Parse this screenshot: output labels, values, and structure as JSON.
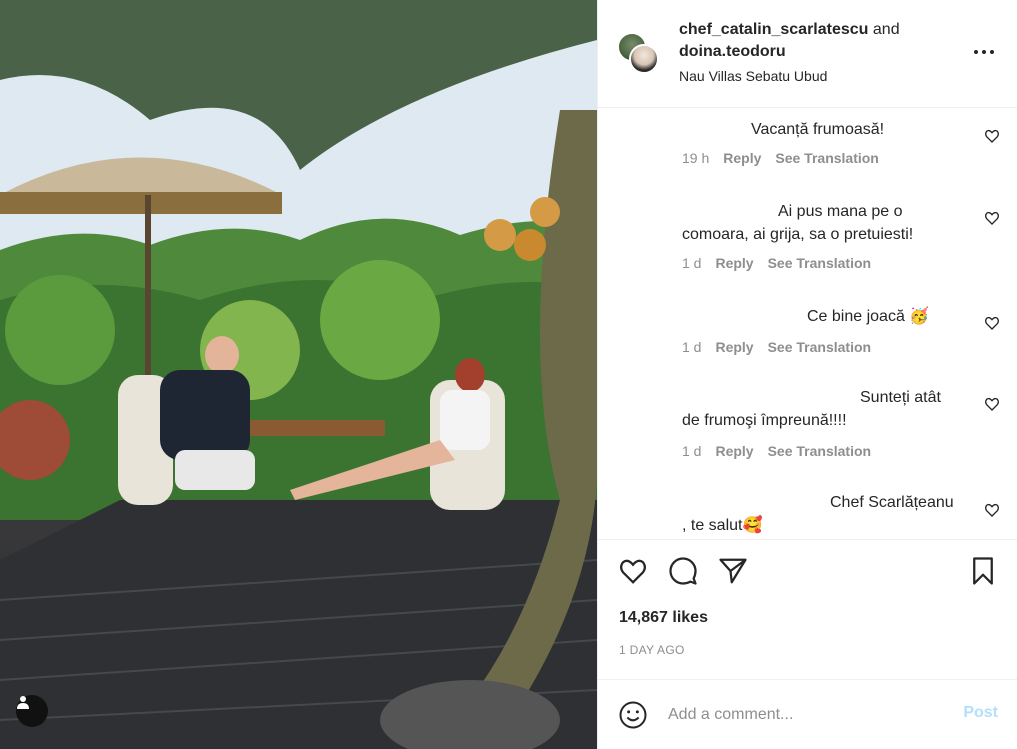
{
  "header": {
    "user1": "chef_catalin_scarlatescu",
    "joiner": "and",
    "user2": "doina.teodoru",
    "location": "Nau Villas Sebatu Ubud"
  },
  "comments": [
    {
      "text": "Vacanță frumoasă!",
      "time": "19 h",
      "reply": "Reply",
      "translate": "See Translation"
    },
    {
      "text_line1": "Ai pus mana pe o",
      "text_line2": "comoara, ai grija, sa o pretuiesti!",
      "time": "1 d",
      "reply": "Reply",
      "translate": "See Translation"
    },
    {
      "text": "Ce bine joacă 🥳",
      "time": "1 d",
      "reply": "Reply",
      "translate": "See Translation"
    },
    {
      "text_line1": "Sunteți atât",
      "text_line2": "de frumoşi împreună!!!!",
      "time": "1 d",
      "reply": "Reply",
      "translate": "See Translation"
    },
    {
      "text_line1": "Chef Scarlățeanu",
      "text_line2": ", te salut🥰"
    }
  ],
  "likes": "14,867 likes",
  "date": "1 DAY AGO",
  "composer": {
    "placeholder": "Add a comment...",
    "post_label": "Post"
  },
  "icons": {
    "like": "heart-icon",
    "comment": "comment-bubble-icon",
    "share": "paper-plane-icon",
    "save": "bookmark-icon",
    "emoji": "smiley-icon",
    "more": "more-dots-icon",
    "tag": "user-tag-icon"
  },
  "colors": {
    "text": "#262626",
    "muted": "#8e8e8e",
    "post_disabled": "#b2dffc",
    "divider": "#efefef"
  }
}
